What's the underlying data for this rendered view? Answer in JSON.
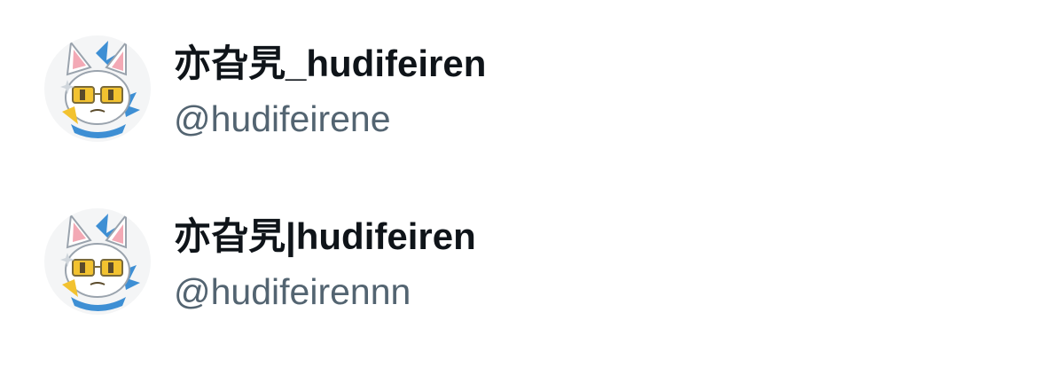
{
  "accounts": [
    {
      "display_name": "亦旮旯_hudifeiren",
      "handle": "@hudifeirene",
      "avatar_icon": "fox-mascot-avatar"
    },
    {
      "display_name": "亦旮旯|hudifeiren",
      "handle": "@hudifeirennn",
      "avatar_icon": "fox-mascot-avatar"
    }
  ],
  "colors": {
    "display_name": "#0f1419",
    "handle": "#536471",
    "background": "#ffffff",
    "avatar_accent_blue": "#3e8fd4",
    "avatar_accent_yellow": "#f2c230",
    "avatar_ear_pink": "#f3a9b5"
  }
}
